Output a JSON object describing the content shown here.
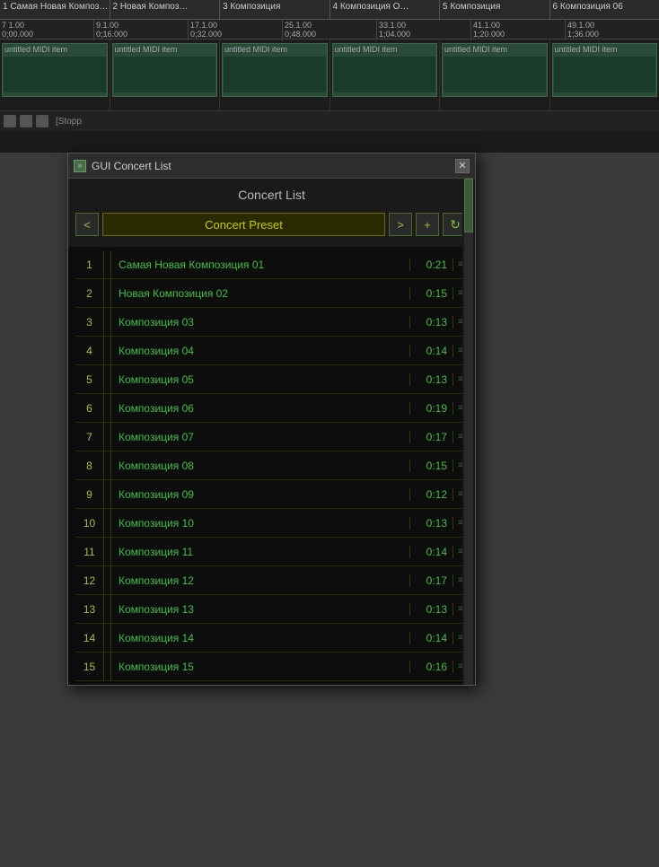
{
  "daw": {
    "track_headers": [
      "1  Самая Новая Композ…",
      "2  Новая Композ…",
      "3  Композиция",
      "4  Композиция О…",
      "5  Композиция",
      "6  Композиция 06"
    ],
    "ruler_marks": [
      {
        "bar": "7  1.00",
        "time": "0;00.000"
      },
      {
        "bar": "9.1.00",
        "time": "0;16.000"
      },
      {
        "bar": "17.1.00",
        "time": "0;32.000"
      },
      {
        "bar": "25.1.00",
        "time": "0;48.000"
      },
      {
        "bar": "33.1.00",
        "time": "1;04.000"
      },
      {
        "bar": "41.1.00",
        "time": "1;20.000"
      },
      {
        "bar": "49.1.00",
        "time": "1;36.000"
      }
    ],
    "midi_label": "untitled MIDI item",
    "transport_status": "[Stopp"
  },
  "modal": {
    "icon_label": "GUI",
    "title": "GUI Concert List",
    "close_label": "✕",
    "heading": "Concert List",
    "preset_nav": {
      "prev_label": "<",
      "preset_name": "Concert Preset",
      "next_label": ">",
      "add_label": "+",
      "refresh_label": "↻"
    },
    "tracks": [
      {
        "num": 1,
        "name": "Самая Новая Композиция 01",
        "duration": "0:21"
      },
      {
        "num": 2,
        "name": "Новая Композиция 02",
        "duration": "0:15"
      },
      {
        "num": 3,
        "name": "Композиция 03",
        "duration": "0:13"
      },
      {
        "num": 4,
        "name": "Композиция 04",
        "duration": "0:14"
      },
      {
        "num": 5,
        "name": "Композиция 05",
        "duration": "0:13"
      },
      {
        "num": 6,
        "name": "Композиция 06",
        "duration": "0:19"
      },
      {
        "num": 7,
        "name": "Композиция 07",
        "duration": "0:17"
      },
      {
        "num": 8,
        "name": "Композиция 08",
        "duration": "0:15"
      },
      {
        "num": 9,
        "name": "Композиция 09",
        "duration": "0:12"
      },
      {
        "num": 10,
        "name": "Композиция 10",
        "duration": "0:13"
      },
      {
        "num": 11,
        "name": "Композиция 11",
        "duration": "0:14"
      },
      {
        "num": 12,
        "name": "Композиция 12",
        "duration": "0:17"
      },
      {
        "num": 13,
        "name": "Композиция 13",
        "duration": "0:13"
      },
      {
        "num": 14,
        "name": "Композиция 14",
        "duration": "0:14"
      },
      {
        "num": 15,
        "name": "Композиция 15",
        "duration": "0:16"
      }
    ]
  },
  "colors": {
    "accent_green": "#40c040",
    "yellow_green": "#a0c040",
    "dark_bg": "#0d0d0d",
    "border_dim": "#2a3a00"
  }
}
